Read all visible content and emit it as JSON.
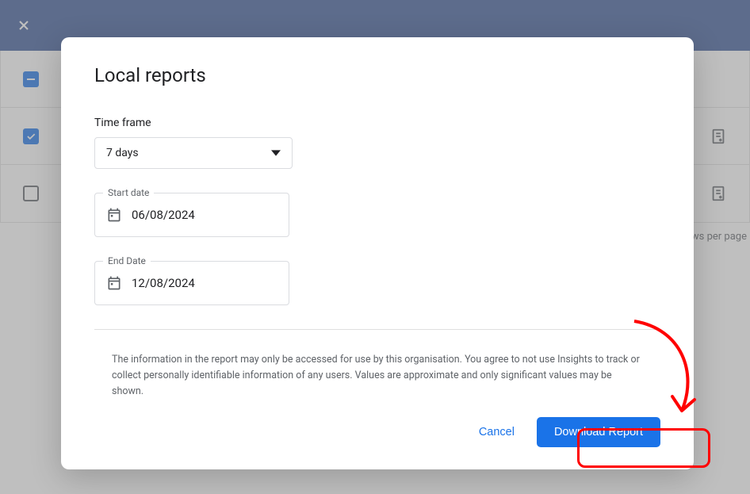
{
  "dialog": {
    "title": "Local reports",
    "time_frame_label": "Time frame",
    "time_frame_value": "7 days",
    "start_date_label": "Start date",
    "start_date_value": "06/08/2024",
    "end_date_label": "End Date",
    "end_date_value": "12/08/2024",
    "disclaimer": "The information in the report may only be accessed for use by this organisation. You agree to not use Insights to track or collect personally identifiable information of any users. Values are approximate and only significant values may be shown.",
    "cancel_label": "Cancel",
    "download_label": "Download Report"
  },
  "background": {
    "footer_text": "ows per page"
  }
}
